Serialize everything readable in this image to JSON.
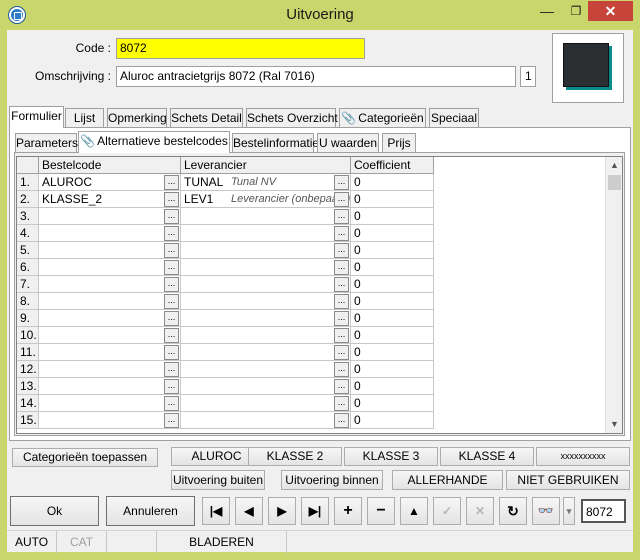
{
  "window": {
    "title": "Uitvoering",
    "min_glyph": "—",
    "max_glyph": "❐",
    "close_glyph": "✕"
  },
  "header": {
    "code_label": "Code :",
    "code_value": "8072",
    "description_label": "Omschrijving :",
    "description_value": "Aluroc antracietgrijs 8072 (Ral 7016)",
    "page_indicator": "1",
    "swatch_color": "#2b2f31"
  },
  "tabs": [
    {
      "label": "Formulier",
      "active": true
    },
    {
      "label": "Lijst"
    },
    {
      "label": "Opmerking"
    },
    {
      "label": "Schets Detail"
    },
    {
      "label": "Schets Overzicht"
    },
    {
      "label": "Categorieën"
    },
    {
      "label": "Speciaal"
    }
  ],
  "subtabs": [
    {
      "label": "Parameters"
    },
    {
      "label": "Alternatieve bestelcodes",
      "active": true
    },
    {
      "label": "Bestelinformatie"
    },
    {
      "label": "U waarden"
    },
    {
      "label": "Prijs"
    }
  ],
  "grid": {
    "columns": [
      "Bestelcode",
      "Leverancier",
      "Coefficient"
    ],
    "ellipsis": "...",
    "rows": [
      {
        "num": "1.",
        "code": "ALUROC",
        "supplier": "TUNAL",
        "supplier_name": "Tunal NV",
        "coef": "0"
      },
      {
        "num": "2.",
        "code": "KLASSE_2",
        "supplier": "LEV1",
        "supplier_name": "Leverancier (onbepaald)",
        "coef": "0"
      },
      {
        "num": "3.",
        "code": "",
        "supplier": "",
        "supplier_name": "",
        "coef": "0"
      },
      {
        "num": "4.",
        "code": "",
        "supplier": "",
        "supplier_name": "",
        "coef": "0"
      },
      {
        "num": "5.",
        "code": "",
        "supplier": "",
        "supplier_name": "",
        "coef": "0"
      },
      {
        "num": "6.",
        "code": "",
        "supplier": "",
        "supplier_name": "",
        "coef": "0"
      },
      {
        "num": "7.",
        "code": "",
        "supplier": "",
        "supplier_name": "",
        "coef": "0"
      },
      {
        "num": "8.",
        "code": "",
        "supplier": "",
        "supplier_name": "",
        "coef": "0"
      },
      {
        "num": "9.",
        "code": "",
        "supplier": "",
        "supplier_name": "",
        "coef": "0"
      },
      {
        "num": "10.",
        "code": "",
        "supplier": "",
        "supplier_name": "",
        "coef": "0"
      },
      {
        "num": "11.",
        "code": "",
        "supplier": "",
        "supplier_name": "",
        "coef": "0"
      },
      {
        "num": "12.",
        "code": "",
        "supplier": "",
        "supplier_name": "",
        "coef": "0"
      },
      {
        "num": "13.",
        "code": "",
        "supplier": "",
        "supplier_name": "",
        "coef": "0"
      },
      {
        "num": "14.",
        "code": "",
        "supplier": "",
        "supplier_name": "",
        "coef": "0"
      },
      {
        "num": "15.",
        "code": "",
        "supplier": "",
        "supplier_name": "",
        "coef": "0"
      }
    ]
  },
  "category_buttons": {
    "apply": "Categorieën toepassen",
    "row1": [
      "ALUROC",
      "KLASSE 2",
      "KLASSE 3",
      "KLASSE 4",
      "xxxxxxxxxx"
    ],
    "row2": [
      "Uitvoering buiten",
      "Uitvoering binnen",
      "ALLERHANDE",
      "NIET GEBRUIKEN"
    ]
  },
  "footer": {
    "ok": "Ok",
    "cancel": "Annuleren",
    "nav_glyphs": [
      "|◀",
      "◀",
      "▶",
      "▶|",
      "+",
      "−",
      "▲",
      "✓",
      "✕",
      "↻",
      "👓",
      "▾"
    ],
    "record_value": "8072"
  },
  "status": {
    "mode": "AUTO",
    "cat": "CAT",
    "state": "BLADEREN"
  }
}
